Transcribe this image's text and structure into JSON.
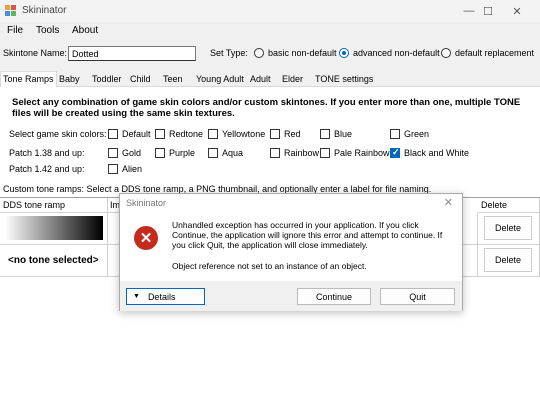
{
  "window": {
    "title": "Skininator",
    "minimize": "—",
    "maximize": "☐",
    "close": "✕"
  },
  "menu": [
    "File",
    "Tools",
    "About"
  ],
  "skintone": {
    "name_label": "Skintone Name:",
    "name_value": "Dotted",
    "set_type_label": "Set Type:",
    "options": [
      "basic non-default",
      "advanced non-default",
      "default replacement"
    ],
    "selected": "advanced non-default"
  },
  "tabs": [
    "Tone Ramps",
    "Baby",
    "Toddler",
    "Child",
    "Teen",
    "Young Adult",
    "Adult",
    "Elder",
    "TONE settings"
  ],
  "active_tab": "Tone Ramps",
  "instructions": "Select any combination of game skin colors and/or custom skintones. If you enter more than one, multiple TONE files will be created using the same skin textures.",
  "game_colors": {
    "row1_label": "Select game skin colors:",
    "row1": [
      "Default",
      "Redtone",
      "Yellowtone",
      "Red",
      "Blue",
      "Green"
    ],
    "row2_label": "Patch 1.38 and up:",
    "row2": [
      "Gold",
      "Purple",
      "Aqua",
      "Rainbow",
      "Pale Rainbow",
      "Black and White"
    ],
    "row3_label": "Patch 1.42 and up:",
    "row3": [
      "Alien"
    ],
    "checked": [
      "Black and White"
    ]
  },
  "custom_ramps_hint": "Custom tone ramps: Select a DDS tone ramp, a PNG thumbnail, and optionally enter a label for file naming.",
  "grid": {
    "col_dds": "DDS tone ramp",
    "col_im": "Im",
    "col_delete": "Delete",
    "rows": [
      {
        "ramp": "",
        "delete": "Delete"
      },
      {
        "ramp": "<no tone selected>",
        "delete": "Delete"
      }
    ]
  },
  "dialog": {
    "title": "Skininator",
    "close": "✕",
    "icon": "error-icon",
    "message": "Unhandled exception has occurred in your application. If you click Continue, the application will ignore this error and attempt to continue. If you click Quit, the application will close immediately.",
    "detail": "Object reference not set to an instance of an object.",
    "details_button": "Details",
    "details_arrow": "▼",
    "continue_button": "Continue",
    "quit_button": "Quit"
  },
  "colors": {
    "accent": "#0067c0",
    "error": "#c42b1c"
  }
}
